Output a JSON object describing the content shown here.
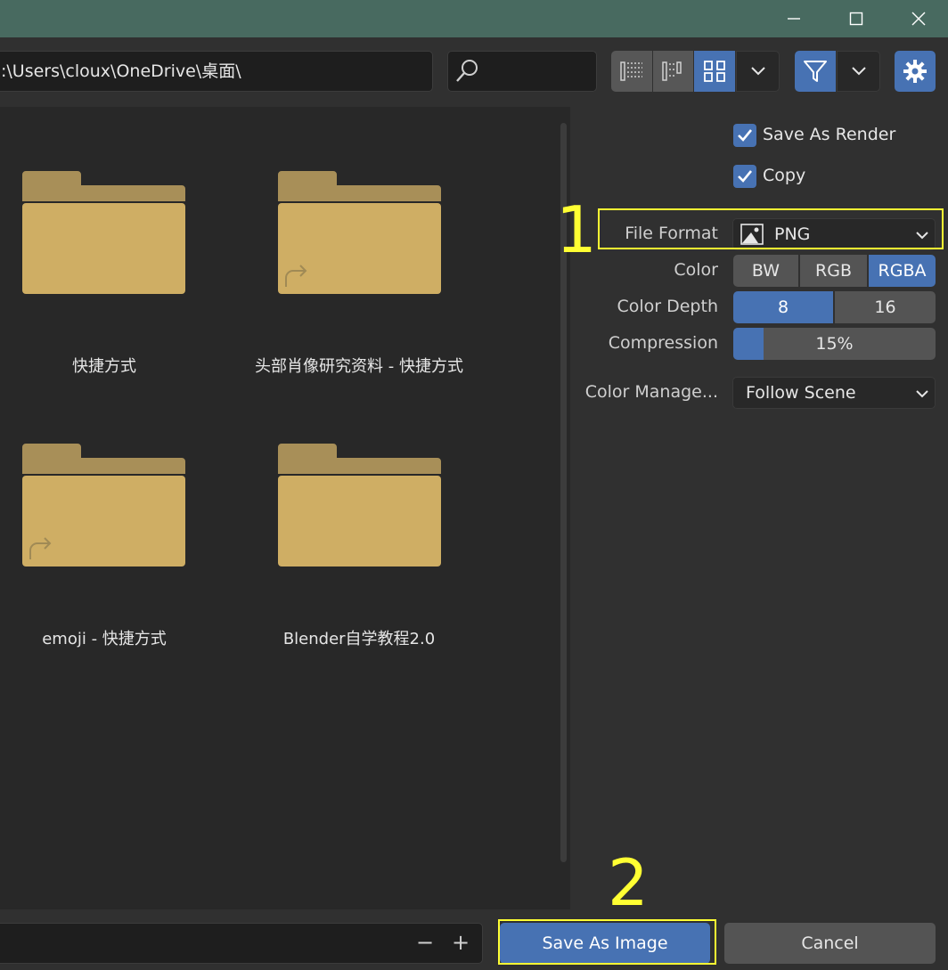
{
  "window": {
    "minimize_icon": "minimize-icon",
    "maximize_icon": "maximize-icon",
    "close_icon": "close-icon"
  },
  "toolbar": {
    "path_value": ":\\Users\\cloux\\OneDrive\\桌面\\",
    "search_value": "",
    "display_modes": [
      "vertical-list",
      "horizontal-list",
      "thumbnails"
    ],
    "active_display_mode": "thumbnails"
  },
  "files": [
    {
      "name": "快捷方式",
      "shortcut": false
    },
    {
      "name": "头部肖像研究资料 - 快捷方式",
      "shortcut": true
    },
    {
      "name": "emoji - 快捷方式",
      "shortcut": true
    },
    {
      "name": "Blender自学教程2.0",
      "shortcut": false
    }
  ],
  "options": {
    "save_as_render": {
      "label": "Save As Render",
      "checked": true
    },
    "copy": {
      "label": "Copy",
      "checked": true
    },
    "file_format": {
      "label": "File Format",
      "value": "PNG"
    },
    "color": {
      "label": "Color",
      "options": [
        "BW",
        "RGB",
        "RGBA"
      ],
      "selected": "RGBA"
    },
    "color_depth": {
      "label": "Color Depth",
      "options": [
        "8",
        "16"
      ],
      "selected": "8"
    },
    "compression": {
      "label": "Compression",
      "value": "15%",
      "fraction": 0.15
    },
    "color_management": {
      "label": "Color Manage...",
      "value": "Follow Scene"
    }
  },
  "footer": {
    "filename_value": "",
    "decrement": "−",
    "increment": "+",
    "save_label": "Save As Image",
    "cancel_label": "Cancel"
  },
  "annotations": {
    "first": "1",
    "second": "2",
    "color": "#ffff33"
  },
  "colors": {
    "accent": "#4772b3",
    "folder": "#cfae64",
    "folder_tab": "#a88f58",
    "titlebar": "#486a60"
  }
}
